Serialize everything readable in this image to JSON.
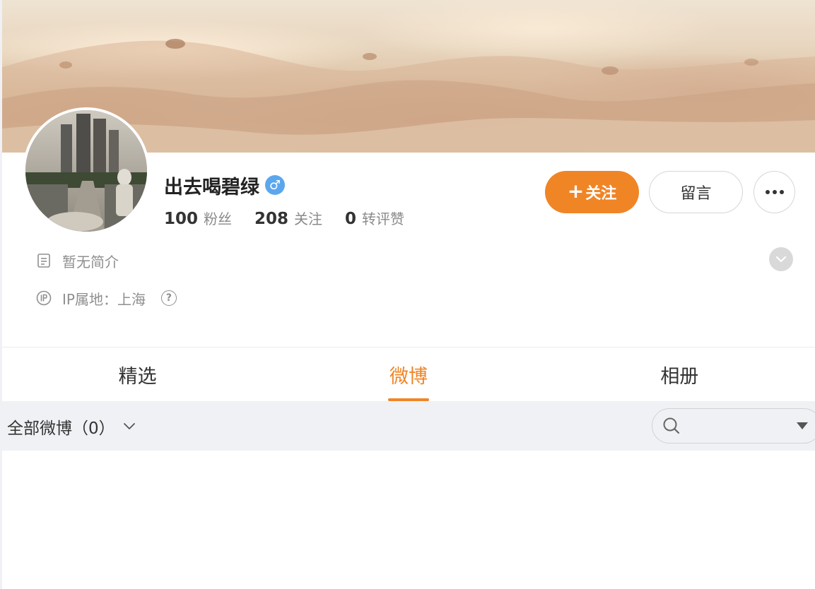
{
  "profile": {
    "username": "出去喝碧绿",
    "gender_symbol": "♂",
    "stats": [
      {
        "num": "100",
        "label": "粉丝"
      },
      {
        "num": "208",
        "label": "关注"
      },
      {
        "num": "0",
        "label": "转评赞"
      }
    ],
    "bio": "暂无简介",
    "ip_location": "IP属地：上海",
    "help_symbol": "?"
  },
  "actions": {
    "follow_plus": "+",
    "follow_label": "关注",
    "message_label": "留言"
  },
  "tabs": [
    {
      "label": "精选",
      "active": false
    },
    {
      "label": "微博",
      "active": true
    },
    {
      "label": "相册",
      "active": false
    }
  ],
  "filter": {
    "label": "全部微博（0）"
  },
  "colors": {
    "accent": "#f08526",
    "gender_badge": "#5ba7ee"
  },
  "icons": {
    "bio": "document-icon",
    "ip": "ip-badge-icon",
    "search": "search-icon",
    "expand": "chevron-down-icon",
    "filter": "chevron-down-icon",
    "more": "ellipsis-icon"
  }
}
